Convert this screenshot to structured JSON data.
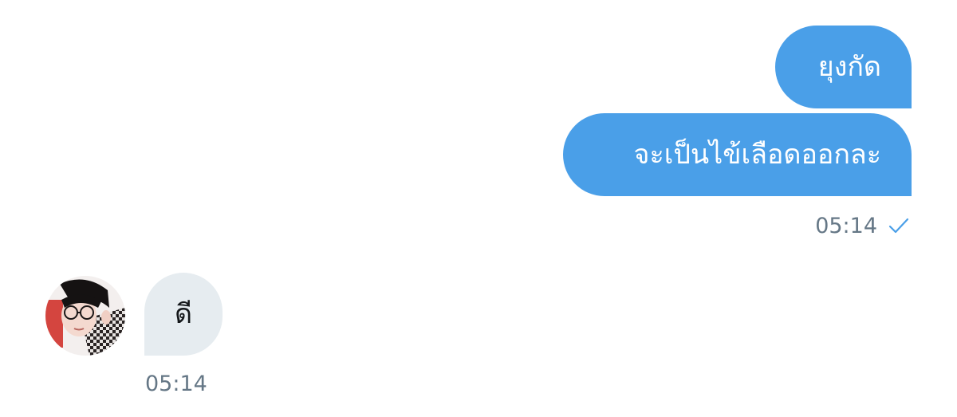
{
  "conversation": {
    "messages": [
      {
        "direction": "outgoing",
        "text": "ยุงกัด"
      },
      {
        "direction": "outgoing",
        "text": "จะเป็นไข้เลือดออกละ",
        "time": "05:14",
        "status_icon": "check-icon"
      },
      {
        "direction": "incoming",
        "text": "ดี",
        "time": "05:14",
        "avatar": "avatar-photo"
      }
    ]
  },
  "colors": {
    "outgoing_bubble": "#4a9fe8",
    "incoming_bubble": "#e6ecf0",
    "timestamp": "#657786",
    "read_check": "#4a9fe8"
  }
}
